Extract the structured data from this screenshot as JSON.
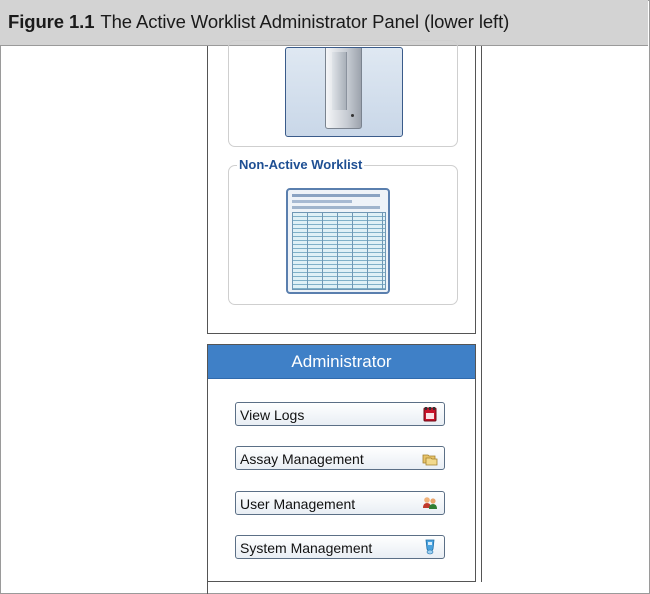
{
  "figure": {
    "label": "Figure 1.1",
    "caption": "The Active Worklist Administrator Panel (lower left)"
  },
  "worklist": {
    "non_active_title": "Non-Active Worklist"
  },
  "admin": {
    "title": "Administrator",
    "buttons": [
      {
        "label": "View Logs",
        "icon": "notebook-icon"
      },
      {
        "label": "Assay Management",
        "icon": "folders-icon"
      },
      {
        "label": "User Management",
        "icon": "users-icon"
      },
      {
        "label": "System Management",
        "icon": "system-icon"
      }
    ]
  },
  "colors": {
    "header_blue": "#3f80c7",
    "title_blue": "#1e4f93",
    "caption_bg": "#d3d3d3"
  }
}
